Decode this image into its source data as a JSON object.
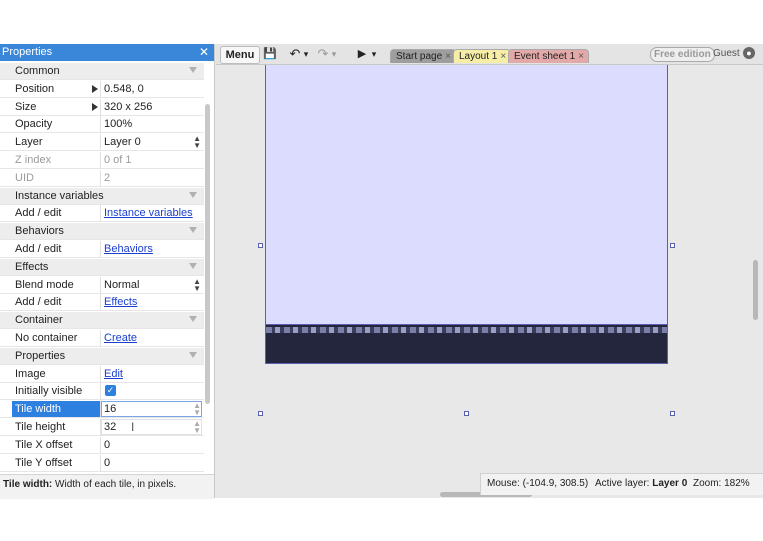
{
  "properties_panel": {
    "title": "Properties",
    "close_glyph": "✕",
    "rows": [
      {
        "kind": "cat",
        "name": "Common"
      },
      {
        "kind": "prop",
        "name": "Position",
        "value": "0.548, 0",
        "expandable": true
      },
      {
        "kind": "prop",
        "name": "Size",
        "value": "320 x 256",
        "expandable": true
      },
      {
        "kind": "prop",
        "name": "Opacity",
        "value": "100%"
      },
      {
        "kind": "prop",
        "name": "Layer",
        "value": "Layer 0",
        "dropdown": true
      },
      {
        "kind": "prop",
        "name": "Z index",
        "value": "0 of 1",
        "disabled": true
      },
      {
        "kind": "prop",
        "name": "UID",
        "value": "2",
        "disabled": true
      },
      {
        "kind": "cat",
        "name": "Instance variables"
      },
      {
        "kind": "link",
        "name": "Add / edit",
        "value": "Instance variables"
      },
      {
        "kind": "cat",
        "name": "Behaviors"
      },
      {
        "kind": "link",
        "name": "Add / edit",
        "value": "Behaviors"
      },
      {
        "kind": "cat",
        "name": "Effects"
      },
      {
        "kind": "prop",
        "name": "Blend mode",
        "value": "Normal",
        "dropdown": true
      },
      {
        "kind": "link",
        "name": "Add / edit",
        "value": "Effects"
      },
      {
        "kind": "cat",
        "name": "Container"
      },
      {
        "kind": "link",
        "name": "No container",
        "value": "Create"
      },
      {
        "kind": "cat",
        "name": "Properties"
      },
      {
        "kind": "link",
        "name": "Image",
        "value": "Edit"
      },
      {
        "kind": "check",
        "name": "Initially visible",
        "value": "✓"
      },
      {
        "kind": "edit",
        "name": "Tile width",
        "value": "16",
        "selected": true
      },
      {
        "kind": "edit",
        "name": "Tile height",
        "value": "32"
      },
      {
        "kind": "prop",
        "name": "Tile X offset",
        "value": "0"
      },
      {
        "kind": "prop",
        "name": "Tile Y offset",
        "value": "0"
      }
    ],
    "footer": {
      "label": "Tile width:",
      "text": " Width of each tile, in pixels."
    }
  },
  "toolbar": {
    "menu_label": "Menu",
    "save_icon": "💾",
    "undo_icon": "↶",
    "redo_icon": "↷",
    "play_icon": "▶",
    "dropdown_glyph": "▾",
    "tabs": [
      {
        "label": "Start page",
        "close": "×",
        "bg": "#9e9e9e"
      },
      {
        "label": "Layout 1",
        "close": "×",
        "bg": "#f6eda6",
        "active": true
      },
      {
        "label": "Event sheet 1",
        "close": "×",
        "bg": "#e3a8a8"
      }
    ],
    "free_edition": "Free edition",
    "guest": "Guest",
    "guest_icon": "👤"
  },
  "status_bar": {
    "mouse": "Mouse: (-104.9, 308.5)",
    "active_layer_label": "Active layer:",
    "active_layer_value": "Layer 0",
    "zoom": "Zoom: 182%"
  },
  "colors": {
    "accent": "#2d7fe0",
    "layout_bg": "#dcdcff",
    "tilemap": "#24263d"
  }
}
